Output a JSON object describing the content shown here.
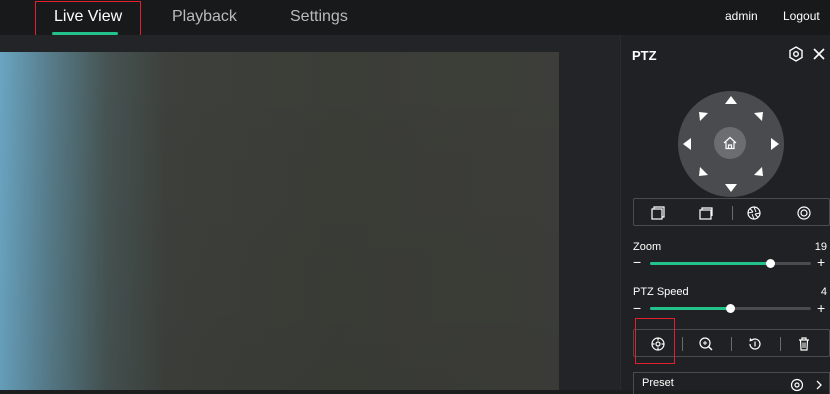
{
  "nav": {
    "tabs": [
      {
        "label": "Live View",
        "active": true
      },
      {
        "label": "Playback",
        "active": false
      },
      {
        "label": "Settings",
        "active": false
      }
    ],
    "user": "admin",
    "logout": "Logout"
  },
  "ptz": {
    "title": "PTZ",
    "zoom": {
      "label": "Zoom",
      "value": "19",
      "fraction": 0.75
    },
    "speed": {
      "label": "PTZ Speed",
      "value": "4",
      "fraction": 0.5
    },
    "preset_label": "Preset"
  },
  "colors": {
    "accent": "#22c28a",
    "highlight": "#e0202a"
  },
  "icons": [
    "settings-icon",
    "close-icon",
    "home-icon",
    "arrow-icons",
    "window-icon",
    "aperture-icon",
    "focus-icon",
    "zoom-area-icon",
    "rotate-icon",
    "delete-icon",
    "eye-icon",
    "chevron-down-icon"
  ]
}
